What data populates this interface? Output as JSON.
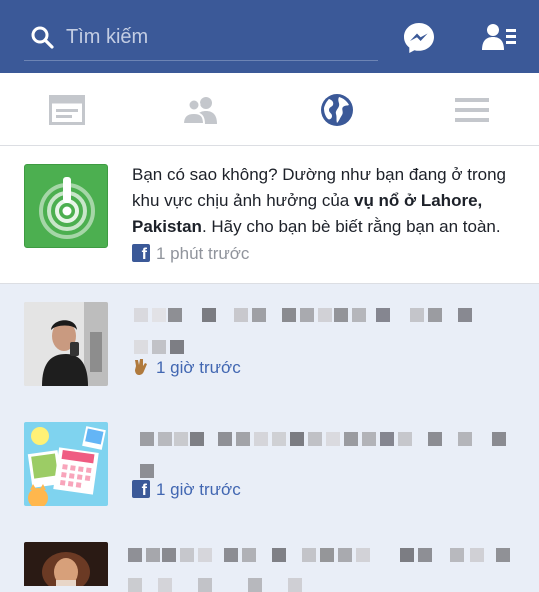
{
  "search": {
    "placeholder": "Tìm kiếm"
  },
  "icons": {
    "search": "search-icon",
    "messenger": "messenger-icon",
    "friend_requests": "friend-requests-icon",
    "news_feed": "news-feed-icon",
    "friends": "friends-icon",
    "notifications": "globe-icon",
    "menu": "menu-icon"
  },
  "colors": {
    "brand": "#3b5998",
    "unread_bg": "#e9eef7",
    "link": "#4267b2",
    "muted": "#90949c",
    "safety_green": "#4caf50"
  },
  "safety_check": {
    "text_before": "Bạn có sao không? Dường như bạn đang ở trong khu vực chịu ảnh hưởng của ",
    "text_bold": "vụ nổ ở Lahore, Pakistan",
    "text_after": ". Hãy cho bạn bè biết rằng bạn an toàn.",
    "time": "1 phút trước"
  },
  "notifications": [
    {
      "time": "1 giờ trước",
      "icon": "reaction-icon"
    },
    {
      "time": "1 giờ trước",
      "icon": "facebook-icon"
    },
    {
      "time": "",
      "icon": ""
    }
  ]
}
